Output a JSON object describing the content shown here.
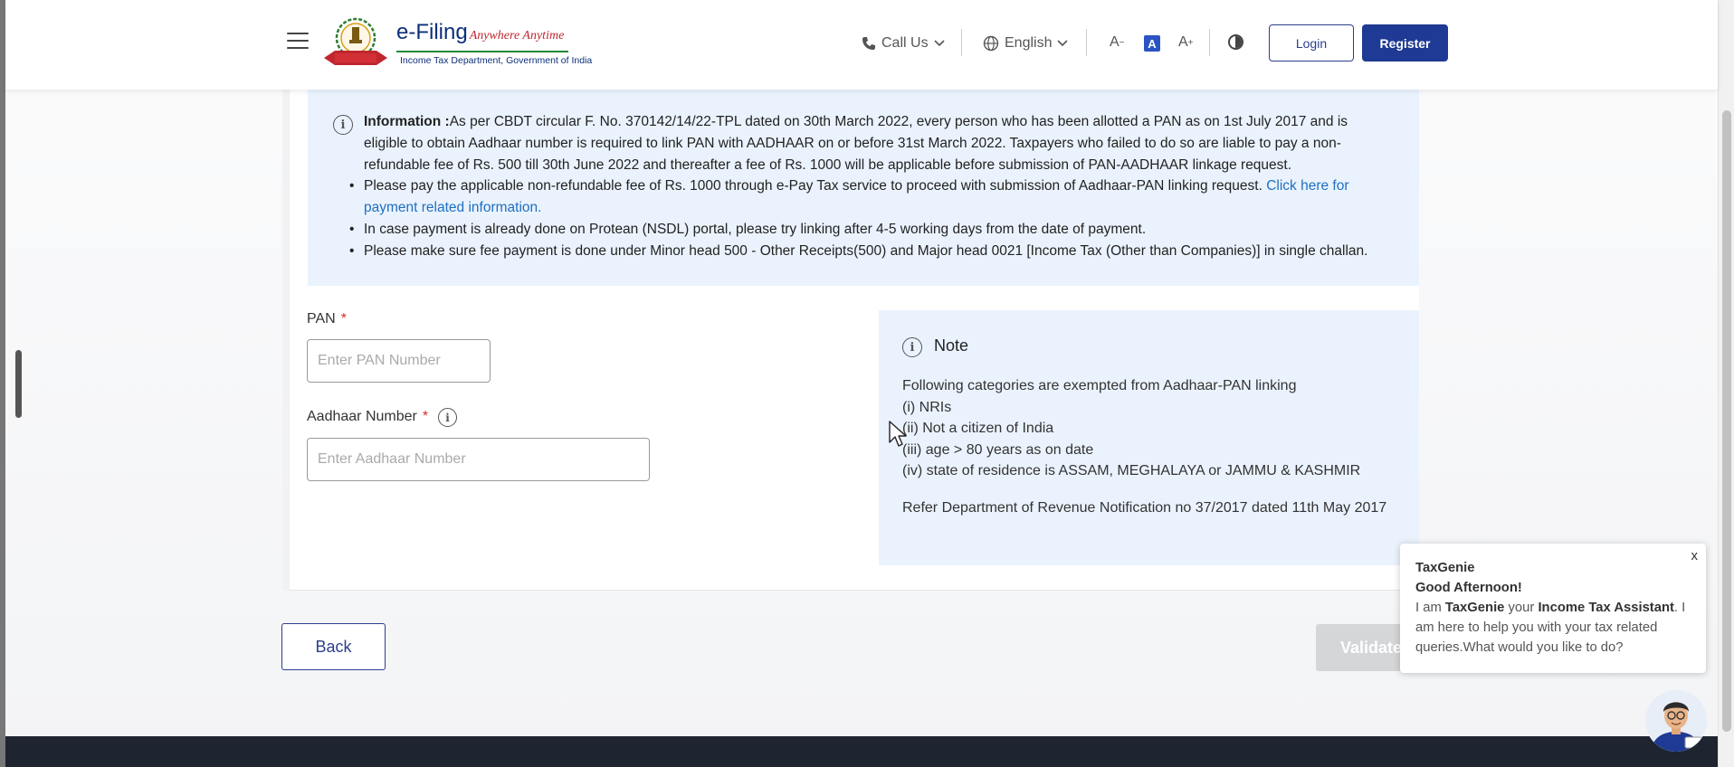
{
  "header": {
    "logo_title": "e-Filing",
    "logo_tagline": "Anywhere Anytime",
    "logo_subtitle": "Income Tax Department, Government of India",
    "call_us_label": "Call Us",
    "language_label": "English",
    "font_decrease": "A",
    "font_normal": "A",
    "font_increase": "A",
    "login_label": "Login",
    "register_label": "Register"
  },
  "info": {
    "heading": "Information :",
    "intro": "As per CBDT circular F. No. 370142/14/22-TPL dated on 30th March 2022, every person who has been allotted a PAN as on 1st July 2017 and is eligible to obtain Aadhaar number is required to link PAN with AADHAAR on or before 31st March 2022. Taxpayers who failed to do so are liable to pay a non-refundable fee of Rs. 500 till 30th June 2022 and thereafter a fee of Rs. 1000 will be applicable before submission of PAN-AADHAAR linkage request.",
    "bullet1": "Please pay the applicable non-refundable fee of Rs. 1000 through e-Pay Tax service to proceed with submission of Aadhaar-PAN linking request. Click here for payment related information.",
    "bullet1_link": "Click here for payment related information.",
    "bullet2": "In case payment is already done on Protean (NSDL) portal, please try linking after 4-5 working days from the date of payment.",
    "bullet3": "Please make sure fee payment is done under Minor head 500 - Other Receipts(500) and Major head 0021 [Income Tax (Other than Companies)] in single challan."
  },
  "form": {
    "pan_label": "PAN",
    "pan_required": "*",
    "pan_placeholder": "Enter PAN Number",
    "pan_value": "",
    "aadhaar_label": "Aadhaar Number",
    "aadhaar_required": "*",
    "aadhaar_placeholder": "Enter Aadhaar Number",
    "aadhaar_value": ""
  },
  "note": {
    "title": "Note",
    "intro": "Following categories are exempted from Aadhaar-PAN linking",
    "items": [
      "(i) NRIs",
      "(ii) Not a citizen of India",
      "(iii) age > 80 years as on date",
      "(iv) state of residence is ASSAM, MEGHALAYA or JAMMU & KASHMIR"
    ],
    "reference": "Refer Department of Revenue Notification no 37/2017 dated 11th May 2017"
  },
  "actions": {
    "back_label": "Back",
    "validate_label": "Validate"
  },
  "chat": {
    "close": "x",
    "title": "TaxGenie",
    "greeting": "Good Afternoon!",
    "msg_prefix": "I am ",
    "msg_name": "TaxGenie",
    "msg_mid": " your ",
    "msg_role": "Income Tax Assistant",
    "msg_suffix": ". I am here to help you with your tax related queries.What would you like to do?"
  },
  "colors": {
    "primary": "#1f3a94",
    "link": "#1f6fc0",
    "info_bg": "#eaf3fd",
    "required": "#d32f2f",
    "footer": "#1e2430"
  }
}
